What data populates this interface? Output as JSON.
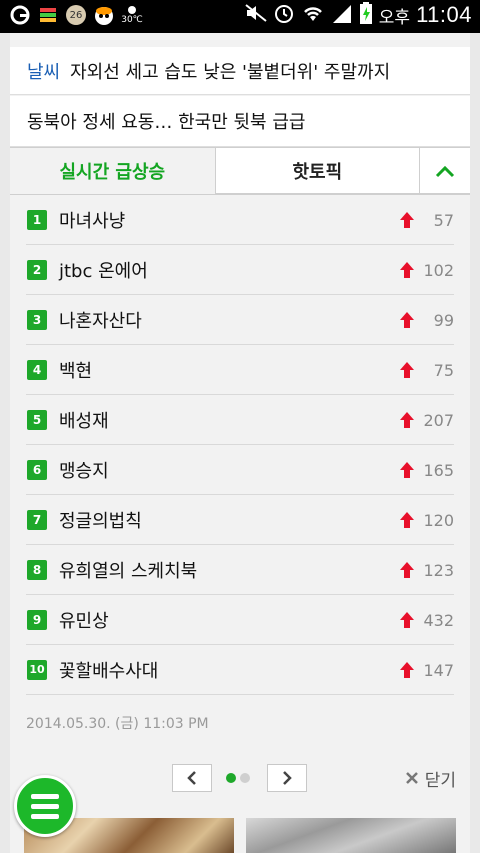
{
  "status_bar": {
    "clock_ampm": "오후",
    "clock_time": "11:04",
    "notification_badges": [
      "26",
      "30℃"
    ]
  },
  "headlines": [
    {
      "tag": "날씨",
      "text": "자외선 세고 습도 낮은 '불볕더위' 주말까지"
    },
    {
      "tag": "",
      "text": "동북아 정세 요동… 한국만 뒷북 급급"
    }
  ],
  "tabs": {
    "realtime_label": "실시간 급상승",
    "hottopic_label": "핫토픽"
  },
  "ranking": [
    {
      "rank": "1",
      "keyword": "마녀사냥",
      "count": "57"
    },
    {
      "rank": "2",
      "keyword": "jtbc 온에어",
      "count": "102"
    },
    {
      "rank": "3",
      "keyword": "나혼자산다",
      "count": "99"
    },
    {
      "rank": "4",
      "keyword": "백현",
      "count": "75"
    },
    {
      "rank": "5",
      "keyword": "배성재",
      "count": "207"
    },
    {
      "rank": "6",
      "keyword": "맹승지",
      "count": "165"
    },
    {
      "rank": "7",
      "keyword": "정글의법칙",
      "count": "120"
    },
    {
      "rank": "8",
      "keyword": "유희열의 스케치북",
      "count": "123"
    },
    {
      "rank": "9",
      "keyword": "유민상",
      "count": "432"
    },
    {
      "rank": "10",
      "keyword": "꽃할배수사대",
      "count": "147"
    }
  ],
  "timestamp": "2014.05.30. (금) 11:03 PM",
  "pager": {
    "close_label": "닫기",
    "current_page": 1,
    "total_pages": 2
  },
  "colors": {
    "accent": "#1ea82a",
    "up_arrow": "#e8102b",
    "link_blue": "#1a5fb4"
  }
}
